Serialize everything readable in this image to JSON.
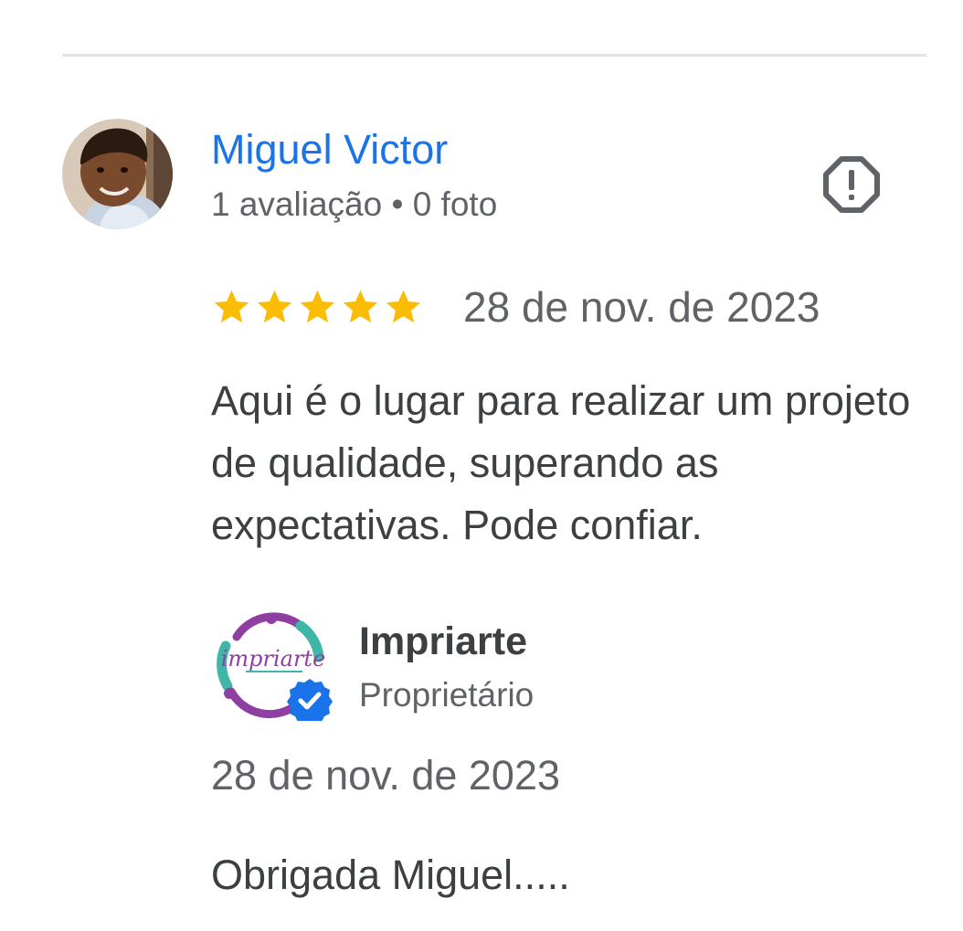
{
  "review": {
    "reviewer_name": "Miguel Victor",
    "reviewer_meta": "1 avaliação • 0 foto",
    "rating": 5,
    "rating_max": 5,
    "date": "28 de nov. de 2023",
    "text": "Aqui é o lugar para realizar um projeto de qualidade, superando as expectativas. Pode confiar.",
    "report_icon": "report-flag-icon"
  },
  "owner_reply": {
    "name": "Impriarte",
    "role": "Proprietário",
    "date": "28 de nov. de 2023",
    "text": "Obrigada Miguel.....",
    "logo_text": "impriarte",
    "verified_icon": "verified-badge-icon"
  },
  "colors": {
    "name_link": "#1a73e8",
    "star": "#fbbc04",
    "secondary_text": "#5f6368",
    "primary_text": "#3c4043",
    "verified_badge": "#1a73e8",
    "logo_purple": "#8e3fa1",
    "logo_teal": "#3fb6a8"
  }
}
